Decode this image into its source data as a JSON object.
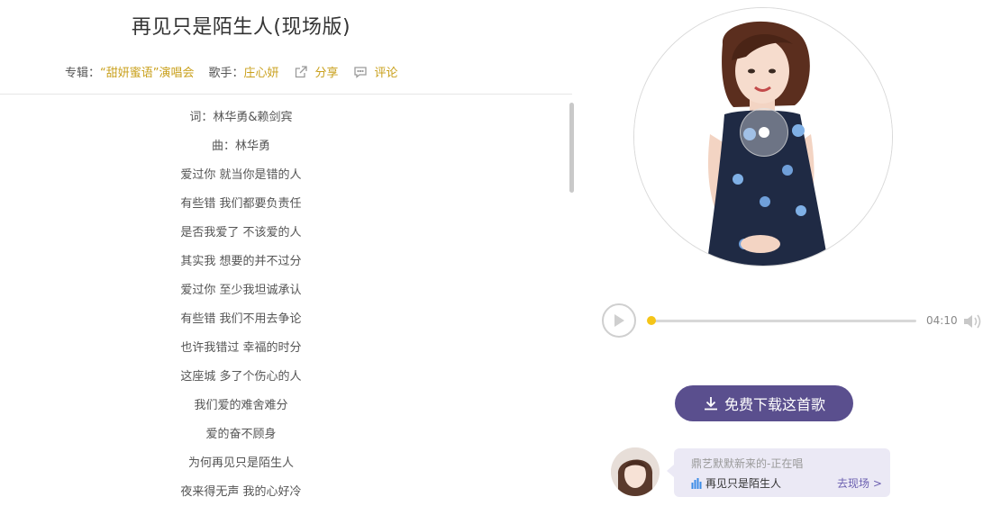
{
  "song": {
    "title": "再见只是陌生人(现场版)",
    "album_label": "专辑：",
    "album": "“甜妍蜜语”演唱会",
    "singer_label": "歌手：",
    "singer": "庄心妍",
    "share": "分享",
    "comment": "评论"
  },
  "lyrics": [
    "词：林华勇&赖剑宾",
    "曲：林华勇",
    "爱过你 就当你是错的人",
    "有些错 我们都要负责任",
    "是否我爱了 不该爱的人",
    "其实我 想要的并不过分",
    "爱过你 至少我坦诚承认",
    "有些错 我们不用去争论",
    "也许我错过 幸福的时分",
    "这座城 多了个伤心的人",
    "我们爱的难舍难分",
    "爱的奋不顾身",
    "为何再见只是陌生人",
    "夜来得无声 我的心好冷"
  ],
  "player": {
    "duration": "04:10",
    "progress": 0
  },
  "download": {
    "label": "免费下载这首歌"
  },
  "live": {
    "status": "鼎艺默默新来的-正在唱",
    "song": "再见只是陌生人",
    "go_label": "去现场 >"
  },
  "colors": {
    "accent_gold": "#c9a01c",
    "button_purple": "#5a4f8e",
    "knob_yellow": "#f5c518"
  }
}
